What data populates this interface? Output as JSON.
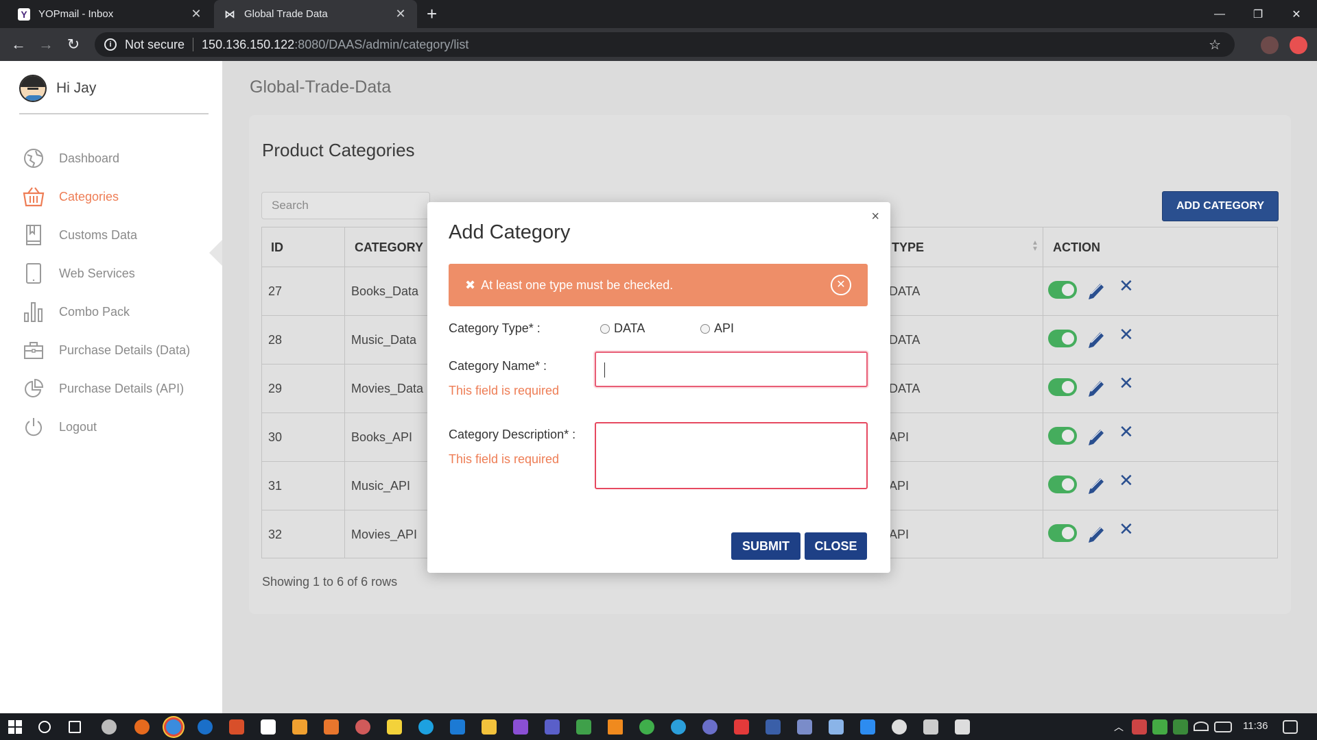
{
  "browser": {
    "tabs": [
      {
        "title": "YOPmail - Inbox",
        "active": false
      },
      {
        "title": "Global Trade Data",
        "active": true
      }
    ],
    "security_label": "Not secure",
    "url_host": "150.136.150.122",
    "url_path": ":8080/DAAS/admin/category/list"
  },
  "sidebar": {
    "greeting": "Hi Jay",
    "items": [
      {
        "label": "Dashboard",
        "icon": "dashboard-icon",
        "active": false
      },
      {
        "label": "Categories",
        "icon": "basket-icon",
        "active": true
      },
      {
        "label": "Customs Data",
        "icon": "book-icon",
        "active": false
      },
      {
        "label": "Web Services",
        "icon": "tablet-icon",
        "active": false
      },
      {
        "label": "Combo Pack",
        "icon": "bar-chart-icon",
        "active": false
      },
      {
        "label": "Purchase Details (Data)",
        "icon": "briefcase-icon",
        "active": false
      },
      {
        "label": "Purchase Details (API)",
        "icon": "pie-chart-icon",
        "active": false
      },
      {
        "label": "Logout",
        "icon": "power-icon",
        "active": false
      }
    ]
  },
  "main": {
    "app_title": "Global-Trade-Data",
    "card_title": "Product Categories",
    "search_placeholder": "Search",
    "add_button": "ADD CATEGORY",
    "columns": {
      "id": "ID",
      "category": "CATEGORY",
      "type": "TYPE",
      "action": "ACTION"
    },
    "rows": [
      {
        "id": "27",
        "category": "Books_Data",
        "type": "DATA"
      },
      {
        "id": "28",
        "category": "Music_Data",
        "type": "DATA"
      },
      {
        "id": "29",
        "category": "Movies_Data",
        "type": "DATA"
      },
      {
        "id": "30",
        "category": "Books_API",
        "type": "API"
      },
      {
        "id": "31",
        "category": "Music_API",
        "type": "API"
      },
      {
        "id": "32",
        "category": "Movies_API",
        "type": "API"
      }
    ],
    "footer": "Showing 1 to 6 of 6 rows"
  },
  "modal": {
    "title": "Add Category",
    "close_glyph": "×",
    "alert": "At least one type must be checked.",
    "type_label": "Category Type* :",
    "type_options": [
      "DATA",
      "API"
    ],
    "name_label": "Category Name* :",
    "name_error": "This field is required",
    "desc_label": "Category Description* :",
    "desc_error": "This field is required",
    "submit": "SUBMIT",
    "close": "CLOSE"
  },
  "taskbar": {
    "time": "11:36"
  },
  "colors": {
    "accent": "#ee7d55",
    "primary_button": "#1e4086",
    "alert_bg": "#ee8e68",
    "toggle_on": "#45ad5d",
    "error": "#ee4060"
  }
}
